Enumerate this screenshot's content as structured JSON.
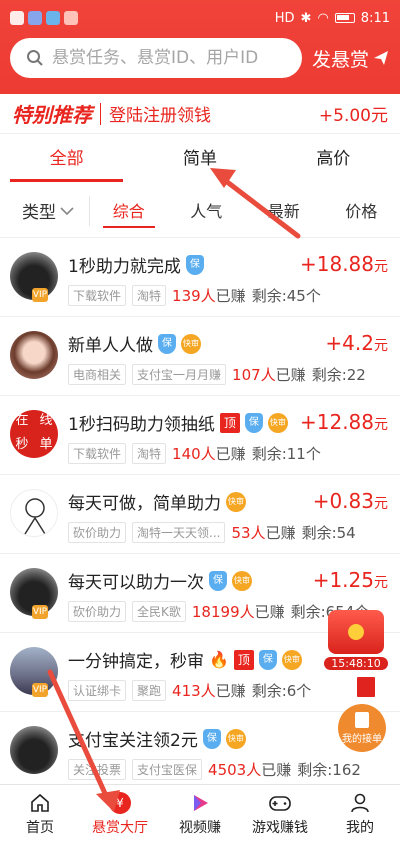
{
  "status": {
    "time": "8:11",
    "network": "HD"
  },
  "search": {
    "placeholder": "悬赏任务、悬赏ID、用户ID",
    "publish_label": "发悬赏"
  },
  "special": {
    "title": "特别推荐",
    "text": "登陆注册领钱",
    "reward": "+5.00元"
  },
  "tabs": [
    {
      "label": "全部"
    },
    {
      "label": "简单"
    },
    {
      "label": "高价"
    }
  ],
  "filters": {
    "type_label": "类型",
    "sorts": [
      {
        "label": "综合"
      },
      {
        "label": "人气"
      },
      {
        "label": "最新"
      },
      {
        "label": "价格"
      }
    ]
  },
  "items": [
    {
      "title": "1秒助力就完成",
      "amount": "+18.88",
      "unit": "元",
      "tags": [
        "下载软件",
        "淘特"
      ],
      "done": "139人",
      "done_suffix": "已赚",
      "remain": "剩余:45个"
    },
    {
      "title": "新单人人做",
      "amount": "+4.2",
      "unit": "元",
      "tags": [
        "电商相关",
        "支付宝一月月赚"
      ],
      "done": "107人",
      "done_suffix": "已赚",
      "remain": "剩余:22"
    },
    {
      "title": "1秒扫码助力领抽纸",
      "amount": "+12.88",
      "unit": "元",
      "tags": [
        "下载软件",
        "淘特"
      ],
      "done": "140人",
      "done_suffix": "已赚",
      "remain": "剩余:11个",
      "avatar_text": [
        "在",
        "线",
        "秒",
        "单"
      ]
    },
    {
      "title": "每天可做，简单助力",
      "amount": "+0.83",
      "unit": "元",
      "tags": [
        "砍价助力",
        "淘特一天天领..."
      ],
      "done": "53人",
      "done_suffix": "已赚",
      "remain": "剩余:54"
    },
    {
      "title": "每天可以助力一次",
      "amount": "+1.25",
      "unit": "元",
      "tags": [
        "砍价助力",
        "全民K歌"
      ],
      "done": "18199人",
      "done_suffix": "已赚",
      "remain": "剩余:654个"
    },
    {
      "title": "一分钟搞定，秒审",
      "amount": "",
      "unit": "",
      "tags": [
        "认证绑卡",
        "聚跑"
      ],
      "done": "413人",
      "done_suffix": "已赚",
      "remain": "剩余:6个"
    },
    {
      "title": "支付宝关注领2元",
      "amount": "",
      "unit": "",
      "tags": [
        "关注投票",
        "支付宝医保"
      ],
      "done": "4503人",
      "done_suffix": "已赚",
      "remain": "剩余:162"
    }
  ],
  "badges": {
    "bao": "保",
    "kuai": "快审",
    "ding": "顶",
    "vip": "VIP"
  },
  "floating": {
    "timer": "15:48:10",
    "orders_label": "我的接单"
  },
  "nav": [
    {
      "label": "首页"
    },
    {
      "label": "悬赏大厅"
    },
    {
      "label": "视频赚"
    },
    {
      "label": "游戏赚钱"
    },
    {
      "label": "我的"
    }
  ],
  "colors": {
    "brand": "#e8251e",
    "header": "#ee3d35",
    "accent_blue": "#5aaef0",
    "accent_orange": "#f5a623"
  }
}
